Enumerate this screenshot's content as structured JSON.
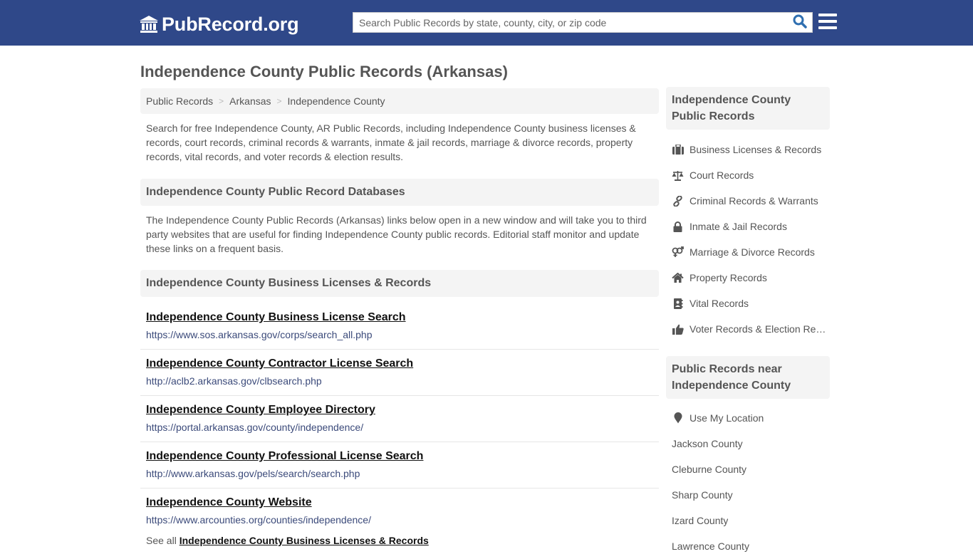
{
  "brand": {
    "name": "PubRecord.org",
    "icon": "courthouse-icon",
    "nav_bg": "#2f4889"
  },
  "search": {
    "placeholder": "Search Public Records by state, county, city, or zip code",
    "value": "",
    "button_icon": "search-icon",
    "button_color": "#2f6fb0"
  },
  "menu": {
    "icon": "hamburger-menu-icon"
  },
  "page": {
    "title": "Independence County Public Records (Arkansas)"
  },
  "breadcrumb": [
    {
      "label": "Public Records"
    },
    {
      "label": "Arkansas"
    },
    {
      "label": "Independence County"
    }
  ],
  "breadcrumb_separator": ">",
  "intro": "Search for free Independence County, AR Public Records, including Independence County business licenses & records, court records, criminal records & warrants, inmate & jail records, marriage & divorce records, property records, vital records, and voter records & election results.",
  "databases": {
    "heading": "Independence County Public Record Databases",
    "description": "The Independence County Public Records (Arkansas) links below open in a new window and will take you to third party websites that are useful for finding Independence County public records. Editorial staff monitor and update these links on a frequent basis."
  },
  "business": {
    "heading": "Independence County Business Licenses & Records",
    "links": [
      {
        "title": "Independence County Business License Search",
        "url": "https://www.sos.arkansas.gov/corps/search_all.php"
      },
      {
        "title": "Independence County Contractor License Search",
        "url": "http://aclb2.arkansas.gov/clbsearch.php"
      },
      {
        "title": "Independence County Employee Directory",
        "url": "https://portal.arkansas.gov/county/independence/"
      },
      {
        "title": "Independence County Professional License Search",
        "url": "http://www.arkansas.gov/pels/search/search.php"
      },
      {
        "title": "Independence County Website",
        "url": "https://www.arcounties.org/counties/independence/"
      }
    ],
    "see_all_prefix": "See all",
    "see_all_link": "Independence County Business Licenses & Records"
  },
  "sidebar": {
    "records_heading": "Independence County Public Records",
    "records_items": [
      {
        "label": "Business Licenses & Records",
        "icon": "briefcase-icon"
      },
      {
        "label": "Court Records",
        "icon": "balance-scale-icon"
      },
      {
        "label": "Criminal Records & Warrants",
        "icon": "link-icon"
      },
      {
        "label": "Inmate & Jail Records",
        "icon": "lock-icon"
      },
      {
        "label": "Marriage & Divorce Records",
        "icon": "venus-mars-icon"
      },
      {
        "label": "Property Records",
        "icon": "home-icon"
      },
      {
        "label": "Vital Records",
        "icon": "address-book-icon"
      },
      {
        "label": "Voter Records & Election Results",
        "icon": "thumbs-up-icon"
      }
    ],
    "nearby_heading": "Public Records near Independence County",
    "use_location": {
      "label": "Use My Location",
      "icon": "map-marker-icon"
    },
    "nearby_items": [
      {
        "label": "Jackson County"
      },
      {
        "label": "Cleburne County"
      },
      {
        "label": "Sharp County"
      },
      {
        "label": "Izard County"
      },
      {
        "label": "Lawrence County"
      }
    ]
  }
}
